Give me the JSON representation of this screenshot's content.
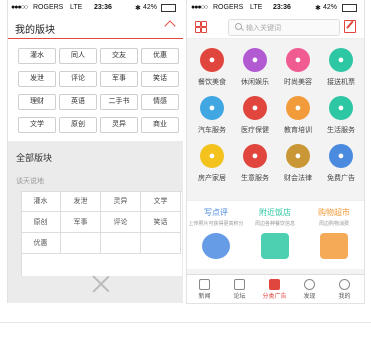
{
  "status": {
    "carrier": "ROGERS",
    "network": "LTE",
    "time": "23:36",
    "battery": "42%"
  },
  "left": {
    "title": "我的版块",
    "my_tags": [
      "灌水",
      "同人",
      "交友",
      "优惠",
      "发泄",
      "评论",
      "军事",
      "笑话",
      "理财",
      "英语",
      "二手书",
      "情感",
      "文学",
      "原创",
      "灵异",
      "商业"
    ],
    "all_title": "全部版块",
    "group_title": "谈天说地",
    "all_tags": [
      "灌水",
      "发泄",
      "灵异",
      "文学",
      "原创",
      "军事",
      "评论",
      "笑话",
      "优惠"
    ]
  },
  "right": {
    "search_placeholder": "输入关键词",
    "services": [
      {
        "label": "餐饮美食",
        "color": "#e0463d",
        "icon": "fork-knife-icon"
      },
      {
        "label": "休闲娱乐",
        "color": "#b15ad1",
        "icon": "martini-icon"
      },
      {
        "label": "时尚美容",
        "color": "#f05b92",
        "icon": "lipstick-icon"
      },
      {
        "label": "接送机票",
        "color": "#2ec7a3",
        "icon": "car-icon"
      },
      {
        "label": "汽车服务",
        "color": "#40a7e3",
        "icon": "wrench-icon"
      },
      {
        "label": "医疗保健",
        "color": "#e0463d",
        "icon": "medical-kit-icon"
      },
      {
        "label": "教育培训",
        "color": "#f29b3a",
        "icon": "graduation-cap-icon"
      },
      {
        "label": "生活服务",
        "color": "#2ec7a3",
        "icon": "lifebuoy-icon"
      },
      {
        "label": "房产家居",
        "color": "#f3c21c",
        "icon": "house-icon"
      },
      {
        "label": "生意服务",
        "color": "#e0463d",
        "icon": "cash-register-icon"
      },
      {
        "label": "财会法律",
        "color": "#c99735",
        "icon": "money-icon"
      },
      {
        "label": "免费广告",
        "color": "#4a8be0",
        "icon": "billboard-icon"
      }
    ],
    "promos": [
      {
        "title": "写点评",
        "sub": "上传照片可获得更高积分",
        "color": "#4a8be0"
      },
      {
        "title": "附近饭店",
        "sub": "周边各种餐饮信息",
        "color": "#2ec7a3"
      },
      {
        "title": "购物超市",
        "sub": "周边购物消费",
        "color": "#f29b3a"
      }
    ],
    "tabs": [
      "新闻",
      "论坛",
      "分类广告",
      "发现",
      "我的"
    ]
  }
}
